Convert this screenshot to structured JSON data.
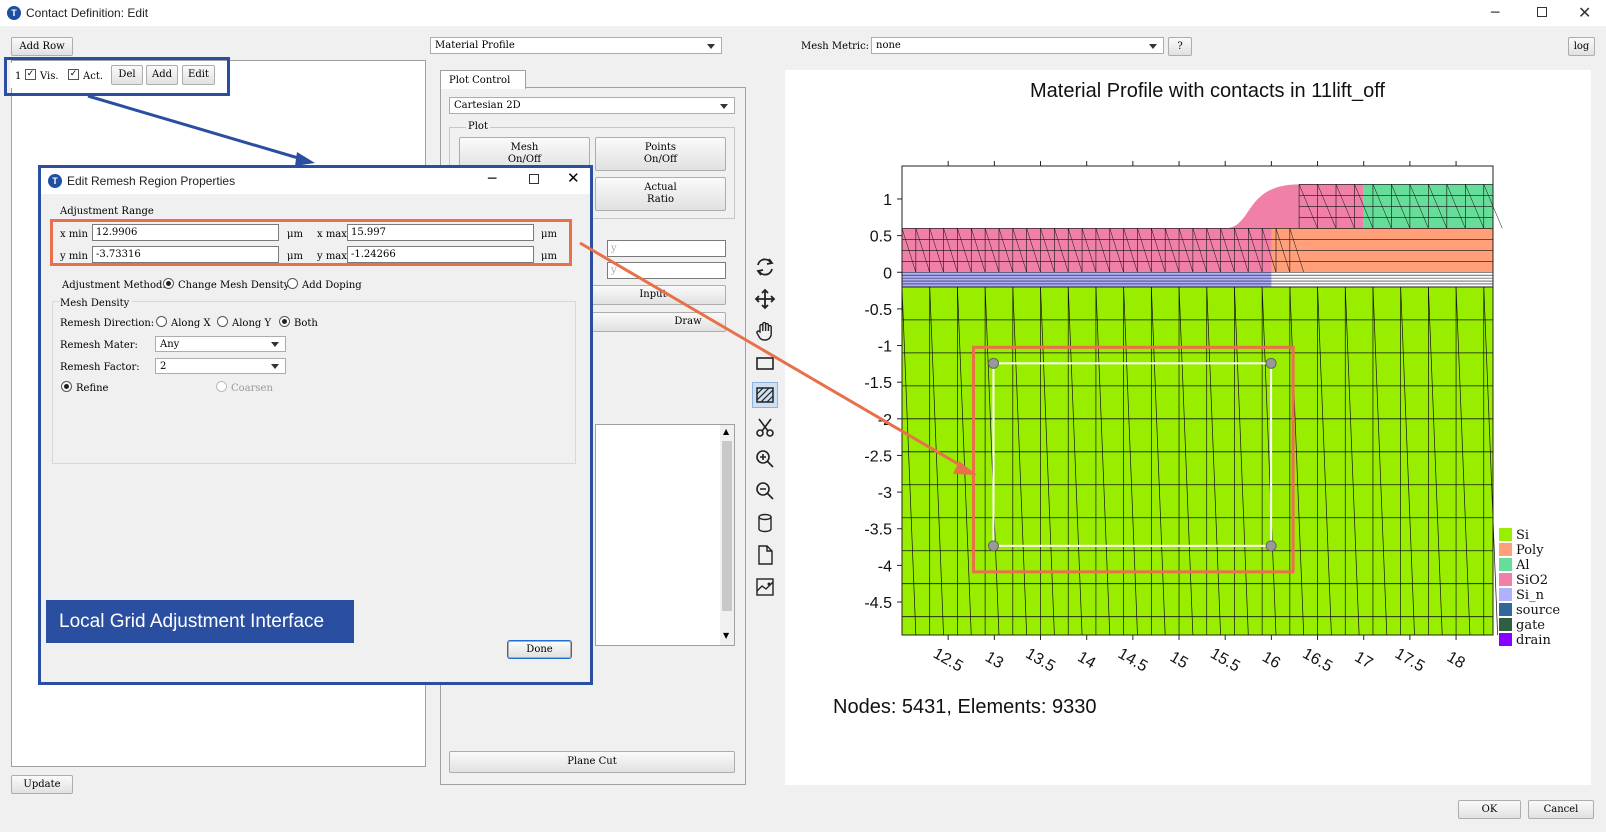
{
  "window": {
    "title": "Contact Definition: Edit",
    "controls": [
      "minimize",
      "maximize",
      "close"
    ]
  },
  "toolbar": {
    "add_row": "Add Row",
    "profile_combo": "Material Profile",
    "mesh_metric_label": "Mesh Metric:",
    "mesh_metric_value": "none",
    "help": "?",
    "log": "log"
  },
  "contact_row": {
    "index": "1",
    "vis_label": "Vis.",
    "act_label": "Act.",
    "del": "Del",
    "add": "Add",
    "edit": "Edit"
  },
  "update_button": "Update",
  "plot_control": {
    "tab": "Plot Control",
    "coord_combo": "Cartesian 2D",
    "plot_group": "Plot",
    "mesh_btn": "Mesh On/Off",
    "points_btn": "Points On/Off",
    "ratio_btn": "Actual Ratio",
    "y_placeholder_1": "y",
    "y_placeholder_2": "y",
    "input_btn": "Input",
    "draw_btn": "Draw",
    "plane_cut": "Plane Cut"
  },
  "dialog": {
    "title": "Edit Remesh Region Properties",
    "adjustment_range": "Adjustment Range",
    "x_min_label": "x min",
    "x_min": "12.9906",
    "x_max_label": "x max",
    "x_max": "15.997",
    "y_min_label": "y min",
    "y_min": "-3.73316",
    "y_max_label": "y max",
    "y_max": "-1.24266",
    "unit": "μm",
    "method_label": "Adjustment Method:",
    "method_change": "Change Mesh Density",
    "method_doping": "Add Doping",
    "mesh_density": "Mesh Density",
    "remesh_dir_label": "Remesh Direction:",
    "dir_x": "Along X",
    "dir_y": "Along Y",
    "dir_both": "Both",
    "remesh_mater_label": "Remesh Mater:",
    "remesh_mater_value": "Any",
    "remesh_factor_label": "Remesh Factor:",
    "remesh_factor_value": "2",
    "refine": "Refine",
    "coarsen": "Coarsen",
    "done": "Done"
  },
  "callout": "Local Grid Adjustment Interface",
  "chart_data": {
    "type": "mesh",
    "title": "Material Profile with contacts in 11lift_off",
    "x_ticks": [
      "12.5",
      "13",
      "13.5",
      "14",
      "14.5",
      "15",
      "15.5",
      "16",
      "16.5",
      "17",
      "17.5",
      "18"
    ],
    "y_ticks": [
      "1",
      "0.5",
      "0",
      "-0.5",
      "-1",
      "-1.5",
      "-2",
      "-2.5",
      "-3",
      "-3.5",
      "-4",
      "-4.5"
    ],
    "xlim": [
      12.0,
      18.4
    ],
    "ylim": [
      -4.95,
      1.45
    ],
    "legend": [
      {
        "name": "Si",
        "color": "#99ee00"
      },
      {
        "name": "Poly",
        "color": "#ffa07a"
      },
      {
        "name": "Al",
        "color": "#66dd99"
      },
      {
        "name": "SiO2",
        "color": "#f080a8"
      },
      {
        "name": "Si_n",
        "color": "#b0b0ff"
      },
      {
        "name": "source",
        "color": "#336699"
      },
      {
        "name": "gate",
        "color": "#2f5f3f"
      },
      {
        "name": "drain",
        "color": "#8800ff"
      }
    ],
    "legend_placement": "bottom-right",
    "remesh_region": {
      "x_min": 12.9906,
      "x_max": 15.997,
      "y_min": -3.73316,
      "y_max": -1.24266
    },
    "footer": "Nodes: 5431, Elements: 9330"
  },
  "dialog_buttons": {
    "ok": "OK",
    "cancel": "Cancel"
  },
  "colors": {
    "highlight_blue": "#2b4fa0",
    "highlight_orange": "#e8704a",
    "callout_bg": "#2b4fa0"
  }
}
